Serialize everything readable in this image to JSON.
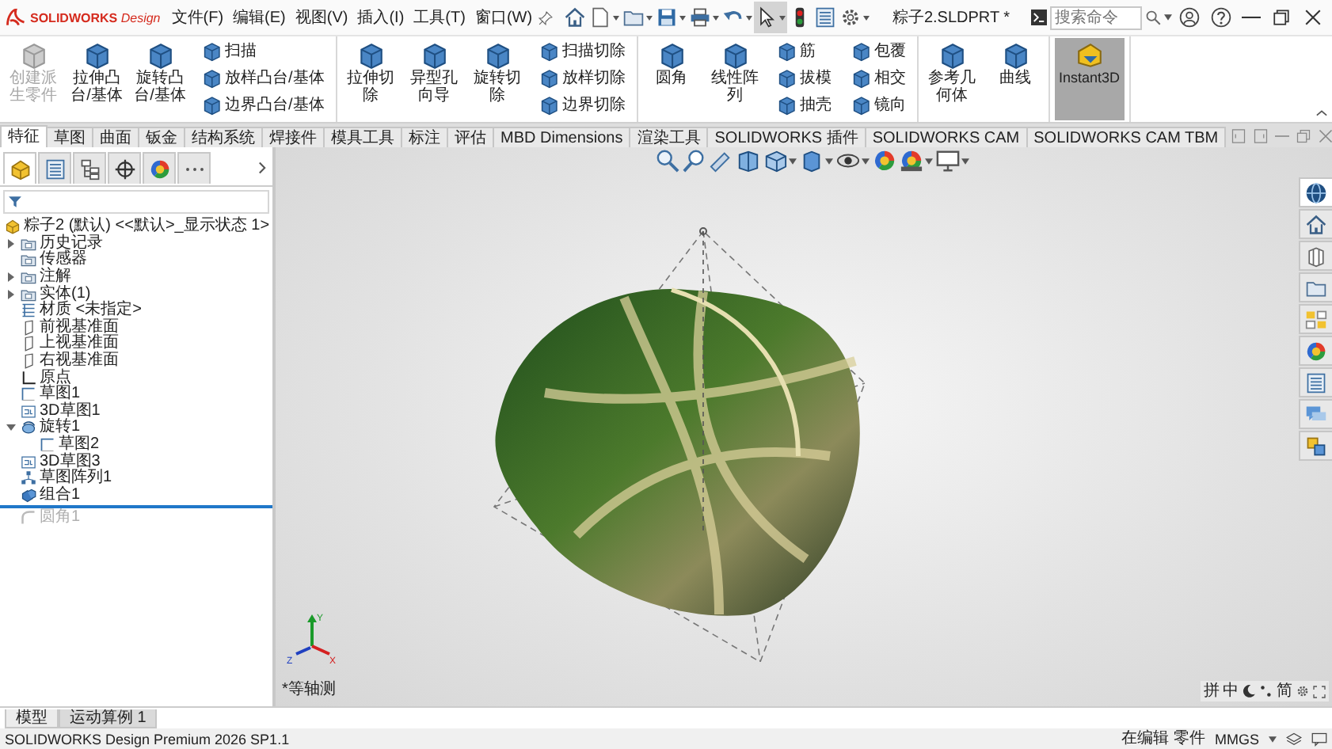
{
  "app": {
    "logo": "**SOLIDWORKS** *Design*",
    "menus": [
      "文件(F)",
      "编辑(E)",
      "视图(V)",
      "插入(I)",
      "工具(T)",
      "窗口(W)"
    ],
    "select_tool_active": true,
    "document_title": "粽子2.SLDPRT *",
    "search": {
      "placeholder": "搜索命令"
    }
  },
  "ribbon": {
    "groups": [
      {
        "items": [
          {
            "kind": "large",
            "label": "创建派生零件",
            "disabled": true
          },
          {
            "kind": "large",
            "label": "拉伸凸台/基体",
            "disabled": false
          },
          {
            "kind": "large",
            "label": "旋转凸台/基体",
            "disabled": false
          },
          {
            "kind": "stack",
            "items": [
              {
                "label": "扫描",
                "disabled": false
              },
              {
                "label": "放样凸台/基体",
                "disabled": false
              },
              {
                "label": "边界凸台/基体",
                "disabled": false
              }
            ]
          }
        ]
      },
      {
        "items": [
          {
            "kind": "large",
            "label": "拉伸切除",
            "disabled": false
          },
          {
            "kind": "large",
            "label": "异型孔向导",
            "disabled": false
          },
          {
            "kind": "large",
            "label": "旋转切除",
            "disabled": false
          },
          {
            "kind": "stack",
            "items": [
              {
                "label": "扫描切除",
                "disabled": false
              },
              {
                "label": "放样切除",
                "disabled": false
              },
              {
                "label": "边界切除",
                "disabled": false
              }
            ]
          }
        ]
      },
      {
        "items": [
          {
            "kind": "large",
            "label": "圆角",
            "disabled": false
          },
          {
            "kind": "large",
            "label": "线性阵列",
            "disabled": false
          },
          {
            "kind": "stack",
            "items": [
              {
                "label": "筋",
                "disabled": false
              },
              {
                "label": "拔模",
                "disabled": false
              },
              {
                "label": "抽壳",
                "disabled": false
              }
            ]
          },
          {
            "kind": "stack",
            "items": [
              {
                "label": "包覆",
                "disabled": false
              },
              {
                "label": "相交",
                "disabled": false
              },
              {
                "label": "镜向",
                "disabled": false
              }
            ]
          }
        ]
      },
      {
        "items": [
          {
            "kind": "large",
            "label": "参考几何体",
            "disabled": false
          },
          {
            "kind": "large",
            "label": "曲线",
            "disabled": false
          }
        ]
      },
      {
        "items": [
          {
            "kind": "toggle",
            "label": "Instant3D",
            "selected": true
          }
        ]
      }
    ]
  },
  "command_tabs": [
    {
      "label": "特征",
      "selected": true
    },
    {
      "label": "草图",
      "selected": false
    },
    {
      "label": "曲面",
      "selected": false
    },
    {
      "label": "钣金",
      "selected": false
    },
    {
      "label": "结构系统",
      "selected": false
    },
    {
      "label": "焊接件",
      "selected": false
    },
    {
      "label": "模具工具",
      "selected": false
    },
    {
      "label": "标注",
      "selected": false
    },
    {
      "label": "评估",
      "selected": false
    },
    {
      "label": "MBD Dimensions",
      "selected": false
    },
    {
      "label": "渲染工具",
      "selected": false
    },
    {
      "label": "SOLIDWORKS 插件",
      "selected": false
    },
    {
      "label": "SOLIDWORKS CAM",
      "selected": false
    },
    {
      "label": "SOLIDWORKS CAM TBM",
      "selected": false
    }
  ],
  "panel_tabs": [
    {
      "selected": true
    },
    {
      "selected": false
    },
    {
      "selected": false
    },
    {
      "selected": false
    },
    {
      "selected": false
    }
  ],
  "feature_tree": {
    "label": "粽子2 (默认) <<默认>_显示状态 1>",
    "kind": "part",
    "disabled": false,
    "children": [
      {
        "label": "历史记录",
        "kind": "folder",
        "expanded": false,
        "disabled": false
      },
      {
        "label": "传感器",
        "kind": "folder",
        "disabled": false
      },
      {
        "label": "注解",
        "kind": "folder",
        "expanded": false,
        "disabled": false
      },
      {
        "label": "实体(1)",
        "kind": "folder",
        "expanded": false,
        "disabled": false
      },
      {
        "label": "材质 <未指定>",
        "kind": "material",
        "disabled": false
      },
      {
        "label": "前视基准面",
        "kind": "plane",
        "disabled": false
      },
      {
        "label": "上视基准面",
        "kind": "plane",
        "disabled": false
      },
      {
        "label": "右视基准面",
        "kind": "plane",
        "disabled": false
      },
      {
        "label": "原点",
        "kind": "origin",
        "disabled": false
      },
      {
        "label": "草图1",
        "kind": "sketch",
        "disabled": false
      },
      {
        "label": "3D草图1",
        "kind": "sketch3d",
        "disabled": false
      },
      {
        "label": "旋转1",
        "kind": "revolve",
        "expanded": true,
        "disabled": false,
        "children": [
          {
            "label": "草图2",
            "kind": "sketch",
            "disabled": false
          }
        ]
      },
      {
        "label": "3D草图3",
        "kind": "sketch3d",
        "disabled": false
      },
      {
        "label": "草图阵列1",
        "kind": "pattern",
        "disabled": false
      },
      {
        "label": "组合1",
        "kind": "combine",
        "disabled": false
      },
      {
        "kind": "rollback-bar"
      },
      {
        "label": "圆角1",
        "kind": "fillet",
        "disabled": true
      }
    ]
  },
  "viewport": {
    "view_name": "*等轴测",
    "triad": {
      "x": "X",
      "y": "Y",
      "z": "Z"
    }
  },
  "task_pane": [
    {
      "selected": true
    },
    {
      "selected": false
    },
    {
      "selected": false
    },
    {
      "selected": false
    },
    {
      "selected": false
    },
    {
      "selected": false
    },
    {
      "selected": false
    },
    {
      "selected": false
    },
    {
      "selected": false
    }
  ],
  "ime_bar": {
    "mode": "拼",
    "language": "中",
    "script": "简"
  },
  "bottom_tabs": [
    {
      "label": "模型",
      "selected": true
    },
    {
      "label": "运动算例 1",
      "selected": false
    }
  ],
  "status_bar": {
    "product": "SOLIDWORKS Design Premium 2026 SP1.1",
    "mode": "在编辑 零件",
    "units": "MMGS"
  }
}
